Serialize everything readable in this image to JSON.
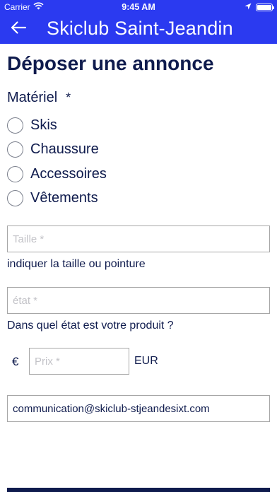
{
  "status_bar": {
    "carrier": "Carrier",
    "time": "9:45 AM",
    "icons": [
      "wifi-icon",
      "location-arrow-icon",
      "battery-icon"
    ],
    "battery_level": 1.0
  },
  "nav": {
    "title": "Skiclub Saint-Jeandin",
    "back_icon": "arrow-left-icon"
  },
  "page": {
    "title": "Déposer une annonce"
  },
  "materiel": {
    "label": "Matériel",
    "required_mark": "*",
    "options": [
      {
        "label": "Skis",
        "selected": false
      },
      {
        "label": "Chaussure",
        "selected": false
      },
      {
        "label": "Accessoires",
        "selected": false
      },
      {
        "label": "Vêtements",
        "selected": false
      }
    ]
  },
  "fields": {
    "taille": {
      "placeholder": "Taille *",
      "value": "",
      "helper": "indiquer la taille ou pointure"
    },
    "etat": {
      "placeholder": "état *",
      "value": "",
      "helper": "Dans quel état est votre produit ?"
    },
    "prix": {
      "placeholder": "Prix *",
      "value": "",
      "prefix": "€",
      "suffix": "EUR"
    },
    "email": {
      "placeholder": "",
      "value": "communication@skiclub-stjeandesixt.com"
    }
  },
  "colors": {
    "brand": "#2b3af0",
    "text": "#0f1b4d",
    "border": "#a7a7a7"
  }
}
